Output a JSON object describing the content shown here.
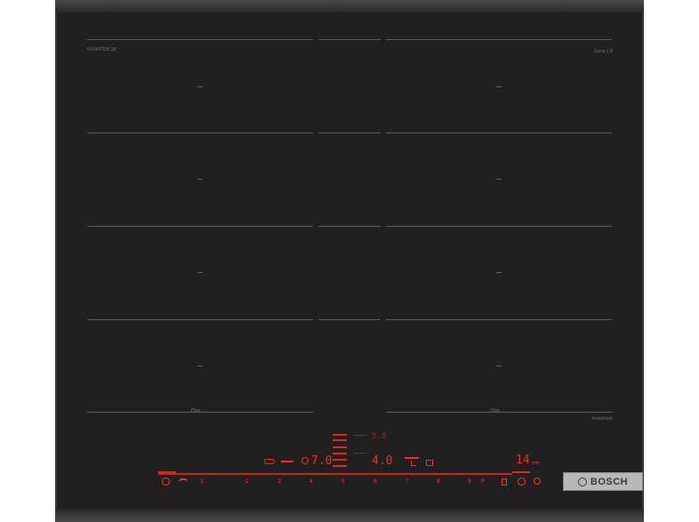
{
  "product": {
    "brand": "BOSCH",
    "model_label": "PXX675DC1E",
    "series_label": "Serie | 8",
    "feature_label": "Induction",
    "flex_label": "Flex"
  },
  "display": {
    "power_main": "7.0",
    "power_secondary": "4.0",
    "power_top": "5.0",
    "timer_value": "14",
    "timer_unit": "min"
  },
  "slider": {
    "labels": [
      "1",
      "2",
      "3",
      "4",
      "5",
      "6",
      "7",
      "8",
      "9"
    ],
    "boost_label": "P"
  },
  "icons": {
    "power": "power-icon",
    "child_lock": "child-lock-icon",
    "timer": "timer-icon",
    "stopwatch": "stopwatch-icon",
    "cooking_assist": "cooking-sensor-icon"
  },
  "colors": {
    "glass": "#211f1f",
    "display_red": "#ff2a1a",
    "badge": "#b9b7b7"
  }
}
